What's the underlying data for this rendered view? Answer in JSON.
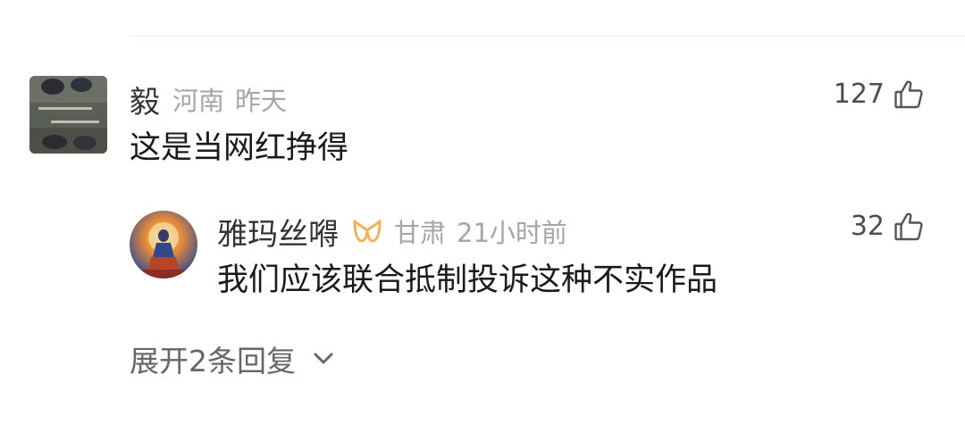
{
  "comment": {
    "author": "毅",
    "location": "河南",
    "time": "昨天",
    "text": "这是当网红挣得",
    "likes": "127",
    "avatar": "photo-avatar",
    "like_icon": "thumbs-up-icon"
  },
  "reply": {
    "author": "雅玛丝嘚",
    "badge": "vip-badge",
    "location": "甘肃",
    "time": "21小时前",
    "text": "我们应该联合抵制投诉这种不实作品",
    "likes": "32",
    "avatar": "painting-avatar",
    "like_icon": "thumbs-up-icon"
  },
  "expand": {
    "label": "展开2条回复",
    "icon": "chevron-down-icon"
  },
  "colors": {
    "name": "#333333",
    "meta": "#a6a6a6",
    "text": "#1a1a1a",
    "badge": "#f0b35a"
  }
}
